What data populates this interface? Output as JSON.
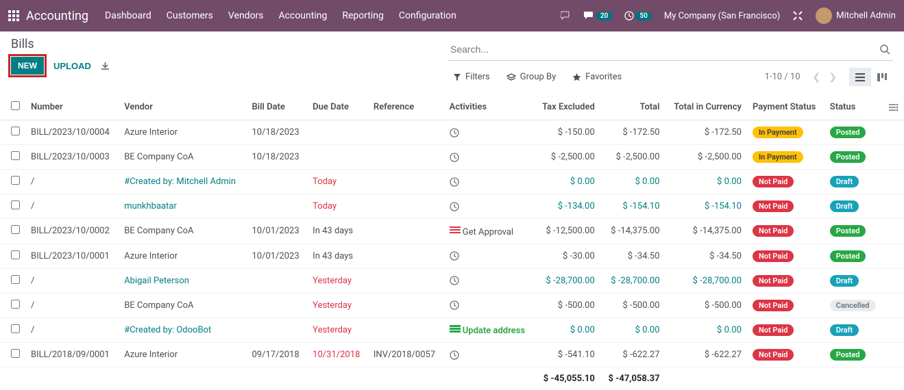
{
  "topbar": {
    "brand": "Accounting",
    "menu": [
      "Dashboard",
      "Customers",
      "Vendors",
      "Accounting",
      "Reporting",
      "Configuration"
    ],
    "chat_badge": "20",
    "clock_badge": "50",
    "company": "My Company (San Francisco)",
    "user": "Mitchell Admin"
  },
  "page": {
    "title": "Bills",
    "new_btn": "NEW",
    "upload_btn": "UPLOAD",
    "search_placeholder": "Search...",
    "filters": "Filters",
    "group_by": "Group By",
    "favorites": "Favorites",
    "pager": "1-10 / 10"
  },
  "columns": {
    "number": "Number",
    "vendor": "Vendor",
    "bill_date": "Bill Date",
    "due_date": "Due Date",
    "reference": "Reference",
    "activities": "Activities",
    "tax_excluded": "Tax Excluded",
    "total": "Total",
    "total_currency": "Total in Currency",
    "payment_status": "Payment Status",
    "status": "Status"
  },
  "rows": [
    {
      "number": "BILL/2023/10/0004",
      "vendor": "Azure Interior",
      "vendor_link": false,
      "bill_date": "10/18/2023",
      "due_date": "",
      "due_red": false,
      "reference": "",
      "activity": "clock",
      "activity_text": "",
      "tax_excluded": "$ -150.00",
      "total": "$ -172.50",
      "total_currency": "$ -172.50",
      "amounts_link": false,
      "payment_status": "In Payment",
      "payment_pill": "yellow",
      "status": "Posted",
      "status_pill": "green"
    },
    {
      "number": "BILL/2023/10/0003",
      "vendor": "BE Company CoA",
      "vendor_link": false,
      "bill_date": "10/18/2023",
      "due_date": "",
      "due_red": false,
      "reference": "",
      "activity": "clock",
      "activity_text": "",
      "tax_excluded": "$ -2,500.00",
      "total": "$ -2,500.00",
      "total_currency": "$ -2,500.00",
      "amounts_link": false,
      "payment_status": "In Payment",
      "payment_pill": "yellow",
      "status": "Posted",
      "status_pill": "green"
    },
    {
      "number": "/",
      "vendor": "#Created by: Mitchell Admin",
      "vendor_link": true,
      "bill_date": "",
      "due_date": "Today",
      "due_red": true,
      "reference": "",
      "activity": "clock",
      "activity_text": "",
      "tax_excluded": "$ 0.00",
      "total": "$ 0.00",
      "total_currency": "$ 0.00",
      "amounts_link": true,
      "payment_status": "Not Paid",
      "payment_pill": "red",
      "status": "Draft",
      "status_pill": "teal"
    },
    {
      "number": "/",
      "vendor": "munkhbaatar",
      "vendor_link": true,
      "bill_date": "",
      "due_date": "Today",
      "due_red": true,
      "reference": "",
      "activity": "clock",
      "activity_text": "",
      "tax_excluded": "$ -134.00",
      "total": "$ -154.10",
      "total_currency": "$ -154.10",
      "amounts_link": true,
      "payment_status": "Not Paid",
      "payment_pill": "red",
      "status": "Draft",
      "status_pill": "teal"
    },
    {
      "number": "BILL/2023/10/0002",
      "vendor": "BE Company CoA",
      "vendor_link": false,
      "bill_date": "10/01/2023",
      "due_date": "In 43 days",
      "due_red": false,
      "reference": "",
      "activity": "bars-red",
      "activity_text": "Get Approval",
      "tax_excluded": "$ -12,500.00",
      "total": "$ -14,375.00",
      "total_currency": "$ -14,375.00",
      "amounts_link": false,
      "payment_status": "Not Paid",
      "payment_pill": "red",
      "status": "Posted",
      "status_pill": "green"
    },
    {
      "number": "BILL/2023/10/0001",
      "vendor": "Azure Interior",
      "vendor_link": false,
      "bill_date": "10/01/2023",
      "due_date": "In 43 days",
      "due_red": false,
      "reference": "",
      "activity": "clock",
      "activity_text": "",
      "tax_excluded": "$ -30.00",
      "total": "$ -34.50",
      "total_currency": "$ -34.50",
      "amounts_link": false,
      "payment_status": "Not Paid",
      "payment_pill": "red",
      "status": "Posted",
      "status_pill": "green"
    },
    {
      "number": "/",
      "vendor": "Abigail Peterson",
      "vendor_link": true,
      "bill_date": "",
      "due_date": "Yesterday",
      "due_red": true,
      "reference": "",
      "activity": "clock",
      "activity_text": "",
      "tax_excluded": "$ -28,700.00",
      "total": "$ -28,700.00",
      "total_currency": "$ -28,700.00",
      "amounts_link": true,
      "payment_status": "Not Paid",
      "payment_pill": "red",
      "status": "Draft",
      "status_pill": "teal"
    },
    {
      "number": "/",
      "vendor": "BE Company CoA",
      "vendor_link": false,
      "bill_date": "",
      "due_date": "Yesterday",
      "due_red": true,
      "reference": "",
      "activity": "clock",
      "activity_text": "",
      "tax_excluded": "$ -500.00",
      "total": "$ -500.00",
      "total_currency": "$ -500.00",
      "amounts_link": false,
      "payment_status": "Not Paid",
      "payment_pill": "red",
      "status": "Cancelled",
      "status_pill": "gray"
    },
    {
      "number": "/",
      "vendor": "#Created by: OdooBot",
      "vendor_link": true,
      "bill_date": "",
      "due_date": "Yesterday",
      "due_red": true,
      "reference": "",
      "activity": "bars-green",
      "activity_text": "Update address",
      "tax_excluded": "$ 0.00",
      "total": "$ 0.00",
      "total_currency": "$ 0.00",
      "amounts_link": true,
      "payment_status": "Not Paid",
      "payment_pill": "red",
      "status": "Draft",
      "status_pill": "teal"
    },
    {
      "number": "BILL/2018/09/0001",
      "vendor": "Azure Interior",
      "vendor_link": false,
      "bill_date": "09/17/2018",
      "due_date": "10/31/2018",
      "due_red": true,
      "reference": "INV/2018/0057",
      "activity": "clock",
      "activity_text": "",
      "tax_excluded": "$ -541.10",
      "total": "$ -622.27",
      "total_currency": "$ -622.27",
      "amounts_link": false,
      "payment_status": "Not Paid",
      "payment_pill": "red",
      "status": "Posted",
      "status_pill": "green"
    }
  ],
  "totals": {
    "tax_excluded": "$ -45,055.10",
    "total": "$ -47,058.37"
  }
}
